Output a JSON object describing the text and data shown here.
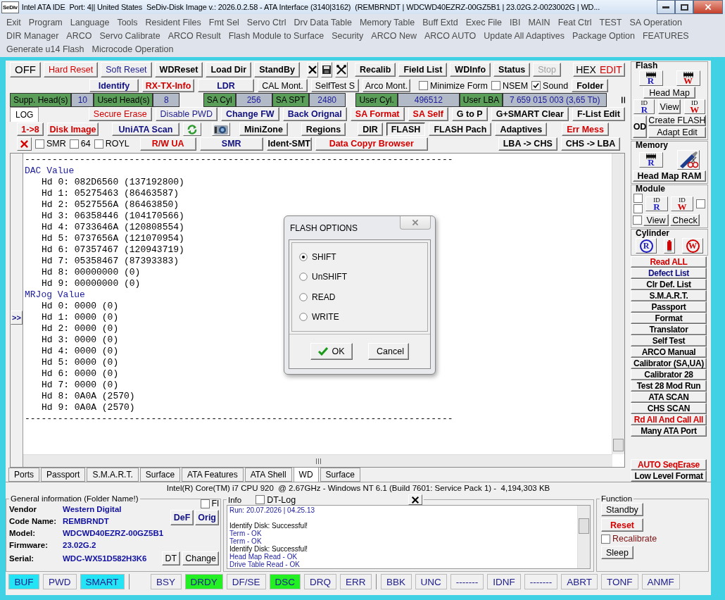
{
  "window": {
    "icon_text": "SeDiv",
    "title": "Intel ATA IDE  Port: 4|| United States  SeDiv-Disk Image v.: 2026.0.2.58 - ATA Interface (3140|3162)  (REMBRNDT | WDCWD40EZRZ-00GZ5B1 | 23.02G.2-0023002G | WD..."
  },
  "menu": [
    [
      "Exit",
      "Program",
      "Language",
      "Tools",
      "Resident Files",
      "Fmt Sel",
      "Servo Ctrl",
      "Drv Data Table",
      "Memory Table",
      "Buff Extd",
      "Exec File",
      "IBI",
      "MAIN",
      "Feat Ctrl",
      "TEST",
      "SA Operation"
    ],
    [
      "DIR Manager",
      "ARCO",
      "Servo Calibrate",
      "ARCO Result",
      "Flash Module to Surface",
      "Security",
      "ARCO New",
      "ARCO AUTO",
      "Update All Adaptives",
      "Package Option",
      "FEATURES"
    ],
    [
      "Generate u14 Flash",
      "Microcode Operation"
    ]
  ],
  "row1": {
    "left": [
      {
        "label": "OFF",
        "kind": "large"
      },
      {
        "label": "Hard Reset",
        "kind": "red"
      },
      {
        "label": "Soft Reset",
        "kind": "blue"
      },
      {
        "label": "WDReset",
        "kind": "bold"
      },
      {
        "label": "Load Dir",
        "kind": "bold"
      },
      {
        "label": "StandBy",
        "kind": "bold"
      }
    ],
    "right": [
      {
        "label": "Recalib",
        "kind": "bold",
        "disabled": false
      },
      {
        "label": "Field List",
        "kind": "bold",
        "disabled": false
      },
      {
        "label": "WDInfo",
        "kind": "bold",
        "disabled": false
      },
      {
        "label": "Status",
        "kind": "bold",
        "disabled": false
      },
      {
        "label": "Stop",
        "kind": "plain",
        "disabled": true
      }
    ],
    "hex_edit": [
      "HEX",
      "EDIT"
    ]
  },
  "row2": {
    "buttons": [
      {
        "label": "Identify",
        "kind": "blue-bold"
      },
      {
        "label": "RX-TX-Info",
        "kind": "red-bold"
      },
      {
        "label": "LDR",
        "kind": "blue-bold"
      },
      {
        "label": "CAL Mont.",
        "kind": "plain"
      },
      {
        "label": "SelfTest S",
        "kind": "plain"
      },
      {
        "label": "Arco Mont.",
        "kind": "plain"
      }
    ],
    "checks": [
      {
        "label": "Minimize Form",
        "checked": false
      },
      {
        "label": "NSEM",
        "checked": false
      },
      {
        "label": "Sound",
        "checked": true
      }
    ],
    "folder": {
      "label": "Folder",
      "kind": "bold"
    }
  },
  "drive_info": [
    [
      {
        "label": "Supp. Head(s)",
        "value": "10"
      },
      {
        "label": "Used Head(s)",
        "value": "8"
      }
    ],
    [
      {
        "label": "SA Cyl",
        "value": "256"
      },
      {
        "label": "SA SPT",
        "value": "2480"
      }
    ],
    [
      {
        "label": "User Cyl.",
        "value": "496512"
      },
      {
        "label": "User LBA",
        "value": "7 659 015 003  (3,65 Tb)"
      }
    ]
  ],
  "row4": {
    "tab": "LOG",
    "buttons": [
      {
        "label": "Secure Erase",
        "kind": "red"
      },
      {
        "label": "Disable PWD",
        "kind": "blue"
      },
      {
        "label": "Change FW",
        "kind": "blue-bold"
      },
      {
        "label": "Back Orignal",
        "kind": "blue-bold"
      },
      {
        "label": "SA Format",
        "kind": "red-bold"
      },
      {
        "label": "SA Self",
        "kind": "red-bold"
      },
      {
        "label": "G to P",
        "kind": "bold"
      },
      {
        "label": "G+SMART Clear",
        "kind": "bold"
      },
      {
        "label": "F-List Edit",
        "kind": "bold"
      }
    ]
  },
  "row5": {
    "left": [
      {
        "label": "1->8",
        "kind": "red-bold",
        "selected": false
      },
      {
        "label": "Disk Image",
        "kind": "red-bold",
        "selected": false
      },
      {
        "label": "UniATA Scan",
        "kind": "blue-bold",
        "selected": false
      }
    ],
    "right": [
      {
        "label": "MiniZone",
        "kind": "bold",
        "selected": false
      },
      {
        "label": "Regions",
        "kind": "bold",
        "selected": false
      },
      {
        "label": "DIR",
        "kind": "bold",
        "selected": false
      },
      {
        "label": "FLASH",
        "kind": "bold",
        "selected": true
      },
      {
        "label": "FLASH Pach",
        "kind": "bold",
        "selected": false
      },
      {
        "label": "Adaptives",
        "kind": "bold",
        "selected": false
      },
      {
        "label": "Err Mess",
        "kind": "red-bold",
        "selected": false
      }
    ]
  },
  "row6": {
    "checks": [
      {
        "label": "SMR",
        "checked": false
      },
      {
        "label": "64",
        "checked": false
      },
      {
        "label": "ROYL",
        "checked": false
      }
    ],
    "buttons": [
      {
        "label": "R/W UA",
        "kind": "red-bold"
      },
      {
        "label": "SMR",
        "kind": "blue-bold"
      },
      {
        "label": "Ident-SMT",
        "kind": "bold"
      },
      {
        "label": "Data Copyr Browser",
        "kind": "red-bold"
      }
    ],
    "right": [
      {
        "label": "LBA -> CHS",
        "kind": "bold"
      },
      {
        "label": "CHS -> LBA",
        "kind": "bold"
      }
    ]
  },
  "log": {
    "expand": ">>",
    "lines": [
      {
        "kind": "rule",
        "text": "------------------------------------------------------------------------------"
      },
      {
        "kind": "header",
        "text": "DAC Value"
      },
      {
        "kind": "entry",
        "text": "Hd 0: 082D6560 (137192800)"
      },
      {
        "kind": "entry",
        "text": "Hd 1: 05275463 (86463587)"
      },
      {
        "kind": "entry",
        "text": "Hd 2: 0527556A (86463850)"
      },
      {
        "kind": "entry",
        "text": "Hd 3: 06358446 (104170566)"
      },
      {
        "kind": "entry",
        "text": "Hd 4: 0733646A (120808554)"
      },
      {
        "kind": "entry",
        "text": "Hd 5: 0737656A (121070954)"
      },
      {
        "kind": "entry",
        "text": "Hd 6: 07357467 (120943719)"
      },
      {
        "kind": "entry",
        "text": "Hd 7: 05358467 (87393383)"
      },
      {
        "kind": "entry",
        "text": "Hd 8: 00000000 (0)"
      },
      {
        "kind": "entry",
        "text": "Hd 9: 00000000 (0)"
      },
      {
        "kind": "header",
        "text": "MRJog Value"
      },
      {
        "kind": "entry",
        "text": "Hd 0: 0000 (0)"
      },
      {
        "kind": "entry",
        "text": "Hd 1: 0000 (0)"
      },
      {
        "kind": "entry",
        "text": "Hd 2: 0000 (0)"
      },
      {
        "kind": "entry",
        "text": "Hd 3: 0000 (0)"
      },
      {
        "kind": "entry",
        "text": "Hd 4: 0000 (0)"
      },
      {
        "kind": "entry",
        "text": "Hd 5: 0000 (0)"
      },
      {
        "kind": "entry",
        "text": "Hd 6: 0000 (0)"
      },
      {
        "kind": "entry",
        "text": "Hd 7: 0000 (0)"
      },
      {
        "kind": "entry",
        "text": "Hd 8: 0A0A (2570)"
      },
      {
        "kind": "entry",
        "text": "Hd 9: 0A0A (2570)"
      },
      {
        "kind": "rule",
        "text": "------------------------------------------------------------------------------"
      }
    ]
  },
  "dialog": {
    "title": "FLASH OPTIONS",
    "options": [
      {
        "label": "SHIFT",
        "selected": true
      },
      {
        "label": "UnSHIFT",
        "selected": false
      },
      {
        "label": "READ",
        "selected": false
      },
      {
        "label": "WRITE",
        "selected": false
      }
    ],
    "ok": "OK",
    "cancel": "Cancel"
  },
  "side": {
    "flash": {
      "title": "Flash",
      "read": "R",
      "write": "W",
      "head_map": "Head Map",
      "id_read": {
        "tag": "ID",
        "letter": "R"
      },
      "view": "View",
      "id_write": {
        "tag": "ID",
        "letter": "W"
      },
      "od": "OD",
      "create": "Create FLASH",
      "adapt": "Adapt Edit"
    },
    "memory": {
      "title": "Memory",
      "read": "R",
      "head_map_ram": "Head Map RAM"
    },
    "module": {
      "title": "Module",
      "id_read": {
        "tag": "ID",
        "letter": "R"
      },
      "id_write": {
        "tag": "ID",
        "letter": "W"
      },
      "view": "View",
      "check": "Check",
      "checks": [
        {
          "checked": false
        },
        {
          "checked": false
        },
        {
          "checked": false
        },
        {
          "checked": false
        }
      ]
    },
    "cylinder": {
      "title": "Cylinder",
      "read": "R",
      "write": "W"
    },
    "buttons": [
      {
        "label": "Read ALL",
        "kind": "red-bold"
      },
      {
        "label": "Defect List",
        "kind": "blue-bold"
      },
      {
        "label": "Clr Def. List",
        "kind": "bold"
      },
      {
        "label": "S.M.A.R.T.",
        "kind": "bold"
      },
      {
        "label": "Passport",
        "kind": "bold"
      },
      {
        "label": "Format",
        "kind": "bold"
      },
      {
        "label": "Translator",
        "kind": "bold"
      },
      {
        "label": "Self Test",
        "kind": "bold"
      },
      {
        "label": "ARCO Manual",
        "kind": "bold"
      },
      {
        "label": "Calibrator (SA,UA)",
        "kind": "bold"
      },
      {
        "label": "Calibrator 28",
        "kind": "bold"
      },
      {
        "label": "Test 28 Mod Run",
        "kind": "bold"
      },
      {
        "label": "ATA SCAN",
        "kind": "bold"
      },
      {
        "label": "CHS SCAN",
        "kind": "bold"
      },
      {
        "label": "Rd All And Call All",
        "kind": "red-bold"
      },
      {
        "label": "Many ATA Port",
        "kind": "bold"
      }
    ],
    "bottom_buttons": [
      {
        "label": "AUTO SeqErase",
        "kind": "red-bold"
      },
      {
        "label": "Low Level Format",
        "kind": "bold"
      }
    ]
  },
  "bottom_tabs": [
    {
      "label": "Ports",
      "selected": false
    },
    {
      "label": "Passport",
      "selected": false
    },
    {
      "label": "S.M.A.R.T.",
      "selected": false
    },
    {
      "label": "Surface",
      "selected": false
    },
    {
      "label": "ATA Features",
      "selected": false
    },
    {
      "label": "ATA Shell",
      "selected": false
    },
    {
      "label": "WD",
      "selected": true
    },
    {
      "label": "Surface",
      "selected": false
    }
  ],
  "system_line": "Intel(R) Core(TM) i7 CPU 920  @ 2.67GHz - Windows NT 6.1 (Build 7601: Service Pack 1) -  4,194,303 KB",
  "general": {
    "title": "General information (Folder Name!)",
    "fl": {
      "label": "Fl",
      "checked": false
    },
    "fields": [
      {
        "label": "Vendor",
        "value": "Western Digital"
      },
      {
        "label": "Code Name:",
        "value": "REMBRNDT"
      },
      {
        "label": "Model:",
        "value": "WDCWD40EZRZ-00GZ5B1"
      },
      {
        "label": "Firmware:",
        "value": "23.02G.2"
      },
      {
        "label": "Serial:",
        "value": "WDC-WX51D582H3K6"
      }
    ],
    "def": "DeF",
    "orig": "Orig",
    "dt": "DT",
    "change": "Change"
  },
  "info": {
    "title": "Info",
    "dt_log": {
      "label": "DT-Log",
      "checked": false
    },
    "lines": [
      {
        "kind": "note",
        "text": "Run: 20.07.2026 | 04.25.13"
      },
      {
        "kind": "blank"
      },
      {
        "kind": "plain",
        "text": "Identify Disk: Successful!"
      },
      {
        "kind": "note",
        "text": "Term - OK"
      },
      {
        "kind": "note",
        "text": "Term - OK"
      },
      {
        "kind": "plain",
        "text": "Identify Disk: Successful!"
      },
      {
        "kind": "note",
        "text": "Head Map Read - OK"
      },
      {
        "kind": "note",
        "text": "Drive Table Read - OK"
      }
    ]
  },
  "function": {
    "title": "Function",
    "standby": "Standby",
    "reset": "Reset",
    "recalibrate": {
      "label": "Recalibrate",
      "checked": false
    },
    "sleep": "Sleep"
  },
  "status": [
    [
      {
        "label": "BUF",
        "on": true
      },
      {
        "label": "PWD",
        "on": false
      },
      {
        "label": "SMART",
        "on": true
      }
    ],
    [
      {
        "label": "BSY",
        "on": false
      },
      {
        "label": "DRDY",
        "on": true
      },
      {
        "label": "DF/SE",
        "on": false
      },
      {
        "label": "DSC",
        "on": true
      },
      {
        "label": "DRQ",
        "on": false
      },
      {
        "label": "ERR",
        "on": false
      }
    ],
    [
      {
        "label": "BBK",
        "on": false
      },
      {
        "label": "UNC",
        "on": false
      },
      {
        "label": "-------",
        "on": false
      },
      {
        "label": "IDNF",
        "on": false
      },
      {
        "label": "-------",
        "on": false
      },
      {
        "label": "ABRT",
        "on": false
      },
      {
        "label": "TONF",
        "on": false
      },
      {
        "label": "ANMF",
        "on": false
      }
    ]
  ]
}
